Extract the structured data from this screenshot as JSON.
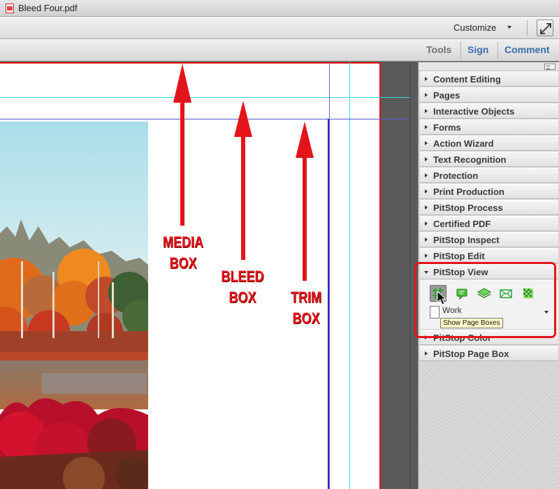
{
  "window": {
    "title": "Bleed Four.pdf"
  },
  "toolbar": {
    "customize_label": "Customize"
  },
  "tabs": [
    {
      "label": "Tools"
    },
    {
      "label": "Sign"
    },
    {
      "label": "Comment"
    }
  ],
  "panel": {
    "sections": [
      {
        "label": "Content Editing"
      },
      {
        "label": "Pages"
      },
      {
        "label": "Interactive Objects"
      },
      {
        "label": "Forms"
      },
      {
        "label": "Action Wizard"
      },
      {
        "label": "Text Recognition"
      },
      {
        "label": "Protection"
      },
      {
        "label": "Print Production"
      },
      {
        "label": "PitStop Process"
      },
      {
        "label": "Certified PDF"
      },
      {
        "label": "PitStop Inspect"
      },
      {
        "label": "PitStop Edit"
      },
      {
        "label": "PitStop View"
      },
      {
        "label": "PitStop Color"
      },
      {
        "label": "PitStop Page Box"
      }
    ],
    "pitstop_view": {
      "doc_label": "Work",
      "tooltip": "Show Page Boxes",
      "icons": [
        "show-page-boxes-icon",
        "comment-icon",
        "layers-icon",
        "envelope-icon",
        "checker-pattern-icon"
      ]
    }
  },
  "annotations": {
    "media_line1": "MEDIA",
    "media_line2": "BOX",
    "bleed_line1": "BLEED",
    "bleed_line2": "BOX",
    "trim_line1": "TRIM",
    "trim_line2": "BOX"
  },
  "colors": {
    "annotation_red": "#e4141b",
    "link_blue": "#3a6fa8",
    "media_box_red": "#e01010",
    "bleed_guide_cyan": "#35d6e6",
    "trim_box_blue": "#2a2ab0"
  }
}
